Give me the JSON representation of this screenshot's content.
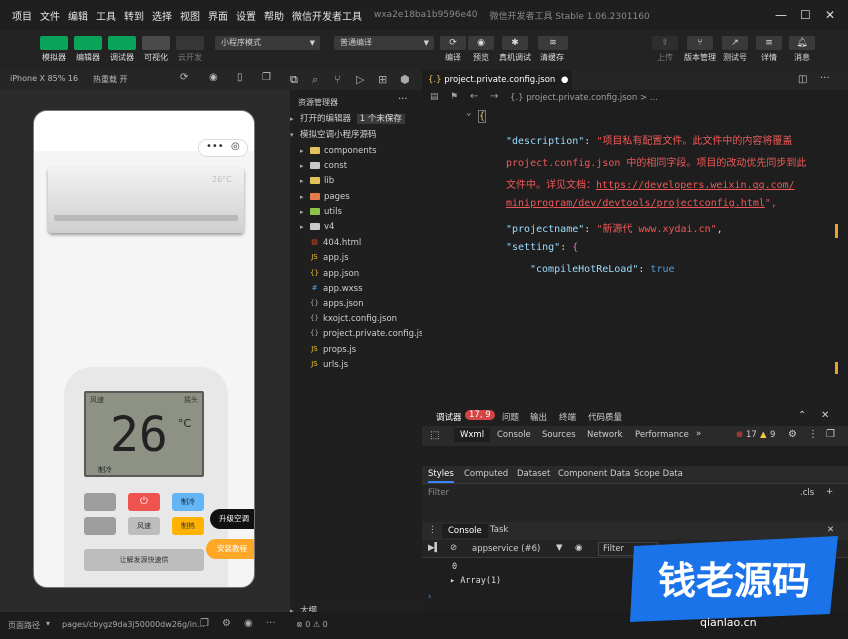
{
  "menu": [
    "项目",
    "文件",
    "编辑",
    "工具",
    "转到",
    "选择",
    "视图",
    "界面",
    "设置",
    "帮助",
    "微信开发者工具"
  ],
  "app_id": "wxa2e18ba1b9596e40",
  "app_title": "微信开发者工具 Stable 1.06.2301160",
  "toolbar": {
    "simulator": "模拟器",
    "editor": "编辑器",
    "debugger": "调试器",
    "visual": "可视化",
    "cloud": "云开发",
    "mode": "小程序模式",
    "compile": "普通编译",
    "compile_btn": "编译",
    "preview": "预览",
    "real_debug": "真机调试",
    "clear_cache": "清缓存",
    "upload": "上传",
    "version": "版本管理",
    "test": "测试号",
    "detail": "详情",
    "message": "消息"
  },
  "sim_header": {
    "device": "iPhone X 85% 16",
    "hot_reload": "热重载 开"
  },
  "phone": {
    "ac_temp_small": "26°C",
    "display_temp": "26",
    "display_unit": "°C",
    "display_mode": "制冷",
    "display_top_left": "风速",
    "display_top_right": "摇头",
    "btn_power": "⏻",
    "btn_cool": "制冷",
    "btn_speed": "风速",
    "btn_heat": "制热",
    "btn_main": "让解发源快速供",
    "float_upgrade": "升级空调",
    "float_install": "安装教程"
  },
  "explorer": {
    "title": "资源管理器",
    "open_editors": "打开的编辑器",
    "unsaved": "1 个未保存",
    "project": "模拟空调小程序源码",
    "items": [
      {
        "name": "components",
        "type": "folder",
        "color": "#e5c15c"
      },
      {
        "name": "const",
        "type": "folder",
        "color": "#c8c8c8"
      },
      {
        "name": "lib",
        "type": "folder",
        "color": "#e5c15c"
      },
      {
        "name": "pages",
        "type": "folder",
        "color": "#e57a4c"
      },
      {
        "name": "utils",
        "type": "folder",
        "color": "#8bc34a"
      },
      {
        "name": "v4",
        "type": "folder",
        "color": "#c8c8c8"
      },
      {
        "name": "404.html",
        "type": "html",
        "color": "#e44d26"
      },
      {
        "name": "app.js",
        "type": "js",
        "color": "#f1c232"
      },
      {
        "name": "app.json",
        "type": "json",
        "color": "#f1c232"
      },
      {
        "name": "app.wxss",
        "type": "wxss",
        "color": "#42a5f5"
      },
      {
        "name": "apps.json",
        "type": "json",
        "color": "#aaaaaa"
      },
      {
        "name": "kxojct.config.json",
        "type": "json",
        "color": "#aaaaaa"
      },
      {
        "name": "project.private.config.json",
        "type": "json",
        "color": "#aaaaaa"
      },
      {
        "name": "props.js",
        "type": "js",
        "color": "#f1c232"
      },
      {
        "name": "urls.js",
        "type": "js",
        "color": "#f1c232"
      }
    ],
    "outline": "大纲"
  },
  "editor": {
    "tab": "project.private.config.json",
    "crumb": "{.} project.private.config.json > ...",
    "desc_key": "\"description\"",
    "desc_val_1": "\"项目私有配置文件。此文件中的内容将覆盖",
    "desc_val_2": "project.config.json 中的相同字段。项目的改动优先同步到此",
    "desc_val_3": "文件中。详见文档：",
    "desc_url_1": "https://developers.weixin.qq.com/",
    "desc_url_2": "miniprogram/dev/devtools/projectconfig.html",
    "desc_end": "\",",
    "name_key": "\"projectname\"",
    "name_val": "\"新源代 www.xydai.cn\"",
    "setting_key": "\"setting\"",
    "hot_key": "\"compileHotReLoad\"",
    "hot_val": "true"
  },
  "devtools": {
    "tabs": [
      "调试器",
      "问题",
      "输出",
      "终端",
      "代码质量"
    ],
    "badge": "17, 9",
    "panels": [
      "Wxml",
      "Console",
      "Sources",
      "Network",
      "Performance"
    ],
    "errors": "17",
    "warnings": "9",
    "style_tabs": [
      "Styles",
      "Computed",
      "Dataset",
      "Component Data",
      "Scope Data"
    ],
    "filter": "Filter",
    "cls": ".cls",
    "console_tabs": [
      "Console",
      "Task"
    ],
    "context": "appservice (#6)",
    "filter2": "Filter",
    "log_0": "0",
    "log_1": "▸ Array(1)"
  },
  "status": {
    "path_label": "页面路径",
    "path": "pages/cbygz9da3j50000dw26g/in...",
    "counts": "⊗ 0 ⚠ 0"
  },
  "watermark": {
    "text": "钱老源码",
    "sub": "qianlao.cn",
    "bg": "#1a73e8"
  }
}
